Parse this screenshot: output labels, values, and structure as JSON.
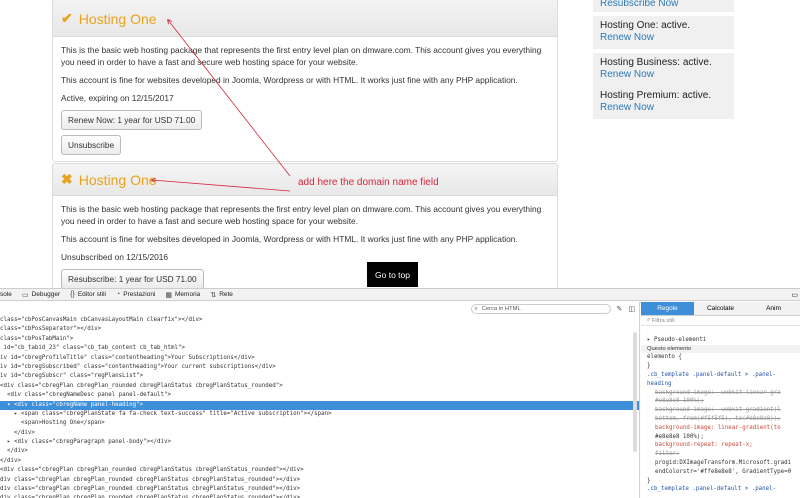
{
  "panels": [
    {
      "state_icon": "check-icon",
      "title": "Hosting One",
      "desc1": "This is the basic web hosting package that represents the first entry level plan on dmware.com. This account gives you everything you need in order to have a fast and secure web hosting space for your website.",
      "desc2": "This account is fine for websites developed in Joomla, Wordpress or with HTML. It works just fine with any PHP application.",
      "status": "Active, expiring on 12/15/2017",
      "primary_button": "Renew Now: 1 year for USD 71.00",
      "secondary_button": "Unsubscribe"
    },
    {
      "state_icon": "cross-icon",
      "title": "Hosting One",
      "desc1": "This is the basic web hosting package that represents the first entry level plan on dmware.com. This account gives you everything you need in order to have a fast and secure web hosting space for your website.",
      "desc2": "This account is fine for websites developed in Joomla, Wordpress or with HTML. It works just fine with any PHP application.",
      "status": "Unsubscribed on 12/15/2016",
      "primary_button": "Resubscribe: 1 year for USD 71.00"
    }
  ],
  "annotation": "add here the domain name field",
  "go_to_top": "Go to top",
  "sidebar": [
    {
      "link": "Resubscribe Now"
    },
    {
      "label": "Hosting One: active.",
      "link": "Renew Now"
    },
    {
      "label": "Hosting Business: active.",
      "link": "Renew Now"
    },
    {
      "label": "Hosting Premium: active.",
      "link": "Renew Now"
    }
  ],
  "devtools": {
    "tabs": [
      "sole",
      "Debugger",
      "Editor stili",
      "Prestazioni",
      "Memoria",
      "Rete"
    ],
    "search_placeholder": "Cerca in HTML",
    "rules_tabs": [
      "Regole",
      "Calcolate",
      "Anim"
    ],
    "filter": "Filtra stili",
    "pseudo": "Pseudo-elementi",
    "this_element": "Questo elemento",
    "element_rule": "elemento {",
    "close_brace": "}",
    "rule_selector_1": ".cb_template .panel-default > .panel-",
    "rule_selector_1b": "heading",
    "decl_1": "background-image: -webkit-linear-gra",
    "decl_1b": "#e8e8e8 100%);",
    "decl_2": "background-image: -webkit-gradient(l",
    "decl_2b": "bottom, from(#f5f5f5), to(#e8e8e8));",
    "decl_3": "background-image: linear-gradient(to",
    "decl_3b": "#e8e8e8 100%);",
    "decl_4": "background-repeat: repeat-x;",
    "decl_5": "filter:",
    "decl_5b": "progid:DXImageTransform.Microsoft.gradi",
    "decl_5c": "endColorstr='#ffe8e8e8', GradientType=0",
    "rule_selector_2": ".cb_template .panel-default > .panel-",
    "code_lines": [
      "class=\"cbPosCanvasMain cbCanvasLayoutMain clearfix\"></div>",
      "class=\"cbPosSeparator\"></div>",
      "class=\"cbPosTabMain\">",
      " id=\"cb_tabid_23\" class=\"cb_tab_content cb_tab_html\">",
      "iv id=\"cbregProfileTitle\" class=\"contentheading\">Your Subscriptions</div>",
      "iv id=\"cbregSubscribed\" class=\"contentheading\">Your current subscriptions</div>",
      "iv id=\"cbregSubscr\" class=\"regPlansList\">",
      "<div class=\"cbregPlan cbregPlan_rounded cbregPlanStatus cbregPlanStatus_rounded\">",
      "  <div class=\"cbregNameDesc panel panel-default\">",
      "  ▾ <div class=\"cbregName panel-heading\">",
      "    ▸ <span class=\"cbregPlanState fa fa-check text-success\" title=\"Active subscription\"></span>",
      "      <span>Hosting One</span>",
      "    </div>",
      "  ▸ <div class=\"cbregParagraph panel-body\"></div>",
      "  </div>",
      "</div>",
      "<div class=\"cbregPlan cbregPlan_rounded cbregPlanStatus cbregPlanStatus_rounded\"></div>",
      "div class=\"cbregPlan cbregPlan_rounded cbregPlanStatus cbregPlanStatus_rounded\"></div>",
      "div class=\"cbregPlan cbregPlan_rounded cbregPlanStatus cbregPlanStatus_rounded\"></div>",
      "div class=\"cbregPlan cbregPlan_rounded cbregPlanStatus cbregPlanStatus_rounded\"></div>"
    ]
  }
}
